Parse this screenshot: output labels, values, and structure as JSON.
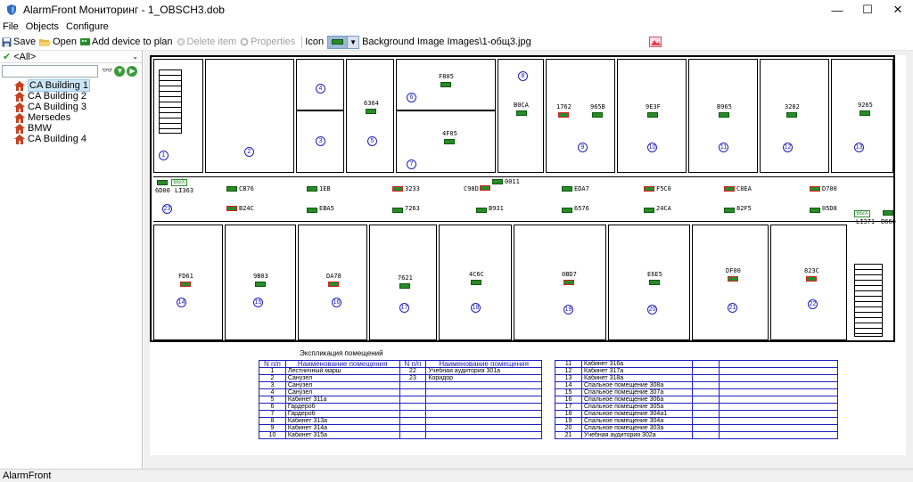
{
  "window": {
    "title": "AlarmFront Мониторинг - 1_OBSCH3.dob",
    "minimize": "—",
    "maximize": "☐",
    "close": "✕"
  },
  "menu": [
    "File",
    "Objects",
    "Configure"
  ],
  "toolbar": {
    "save": "Save",
    "open": "Open",
    "add_device": "Add device to plan",
    "delete_item": "Delete item",
    "properties": "Properties",
    "icon": "Icon",
    "background": "Background Image Images\\1-общ3.jpg"
  },
  "left": {
    "filter": "<All>",
    "search_value": "",
    "tree": [
      "CA Building 1",
      "CA Building 2",
      "CA Building 3",
      "Mersedes",
      "BMW",
      "CA Building 4"
    ],
    "selected": "CA Building 1"
  },
  "status": "AlarmFront",
  "plan": {
    "room_numbers": [
      "1",
      "2",
      "3",
      "4",
      "5",
      "6",
      "7",
      "8",
      "9",
      "10",
      "11",
      "12",
      "13",
      "14",
      "15",
      "16",
      "17",
      "18",
      "19",
      "20",
      "21",
      "22",
      "23"
    ],
    "devices_top": [
      "F805",
      "6364",
      "4F05",
      "B0CA",
      "1762",
      "965B",
      "9E3F",
      "B965",
      "3282",
      "9265"
    ],
    "devices_corridor_row1": [
      "6D00",
      "CB76",
      "1EB",
      "3233",
      "C98D",
      "0011",
      "EDA7",
      "F5C0",
      "C8EA",
      "D700"
    ],
    "devices_corridor_row2": [
      "LI363",
      "B24C",
      "EBA5",
      "7263",
      "B931",
      "6576",
      "24CA",
      "82F5",
      "05D8",
      "LI371",
      "B660"
    ],
    "devices_bottom": [
      "FD61",
      "9B03",
      "DA78",
      "7621",
      "4C6C",
      "0BD7",
      "E6E5",
      "DF00",
      "823C"
    ],
    "exit_label": "ВЫХ"
  },
  "explication": {
    "title": "Экспликация помещений",
    "header_num": "N п/п",
    "header_name": "Наименование помещения",
    "left_rows": [
      [
        "1",
        "Лестничный марш"
      ],
      [
        "2",
        "Санузел"
      ],
      [
        "3",
        "Санузел"
      ],
      [
        "4",
        "Санузел"
      ],
      [
        "5",
        "Кабинет 311а"
      ],
      [
        "6",
        "Гардероб"
      ],
      [
        "7",
        "Гардероб"
      ],
      [
        "8",
        "Кабинет 313а"
      ],
      [
        "9",
        "Кабинет 314а"
      ],
      [
        "10",
        "Кабинет 315а"
      ]
    ],
    "mid_rows": [
      [
        "22",
        "Учебная аудитория 301а"
      ],
      [
        "23",
        "Коридор"
      ]
    ],
    "right_rows": [
      [
        "11",
        "Кабинет 316а"
      ],
      [
        "12",
        "Кабинет 317а"
      ],
      [
        "13",
        "Кабинет 318а"
      ],
      [
        "14",
        "Спальное помещение 308а"
      ],
      [
        "15",
        "Спальное помещение 307а"
      ],
      [
        "16",
        "Спальное помещение 306а"
      ],
      [
        "17",
        "Спальное помещение 305а"
      ],
      [
        "18",
        "Спальное помещение 304а1"
      ],
      [
        "19",
        "Спальное помещение 304а"
      ],
      [
        "20",
        "Спальное помещение 303а"
      ],
      [
        "21",
        "Учебная аудитория 302а"
      ]
    ]
  },
  "colors": {
    "accent_blue": "#2020c0",
    "device_green": "#2a8a2a",
    "alarm_red": "#d02020"
  }
}
